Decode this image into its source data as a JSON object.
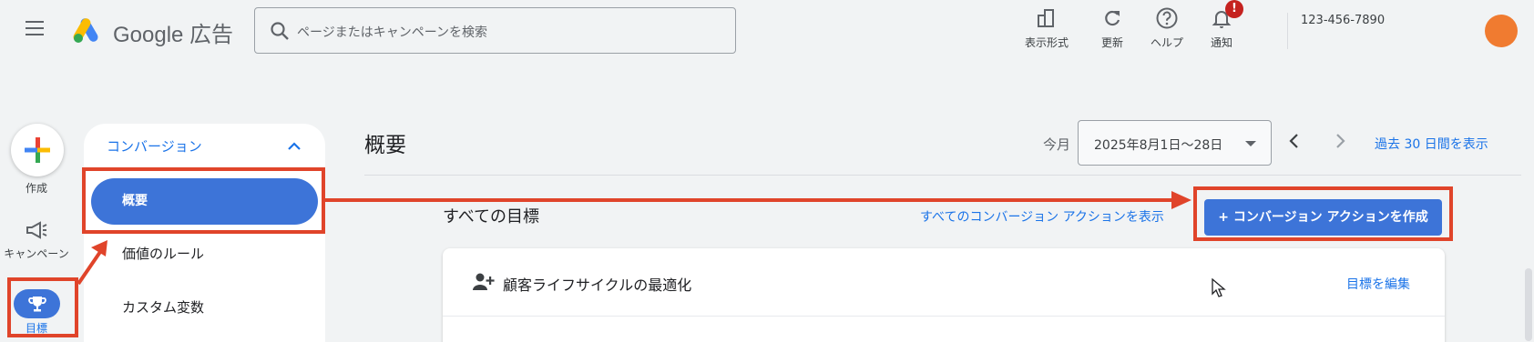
{
  "app": {
    "brand": "Google 広告"
  },
  "search": {
    "placeholder": "ページまたはキャンペーンを検索"
  },
  "toolbar": {
    "view_label": "表示形式",
    "refresh_label": "更新",
    "help_label": "ヘルプ",
    "notify_label": "通知",
    "notify_badge": "!"
  },
  "account": {
    "id": "123-456-7890"
  },
  "rail": {
    "create_label": "作成",
    "campaigns_label": "キャンペーン",
    "goals_label": "目標"
  },
  "subnav": {
    "header": "コンバージョン",
    "items": [
      {
        "label": "概要",
        "active": true
      },
      {
        "label": "価値のルール"
      },
      {
        "label": "カスタム変数"
      }
    ]
  },
  "main": {
    "title": "概要",
    "date_range_label": "今月",
    "date_range_value": "2025年8月1日〜28日",
    "past_30_link": "過去 30 日間を表示",
    "section_title": "すべての目標",
    "show_all_link": "すべてのコンバージョン アクションを表示",
    "create_action_label": "+ コンバージョン アクションを作成",
    "card": {
      "title": "顧客ライフサイクルの最適化",
      "edit_link": "目標を編集"
    }
  },
  "colors": {
    "accent": "#3d74d8",
    "link": "#1a73e8",
    "annotation": "#e0442a",
    "avatar": "#f07b30"
  }
}
